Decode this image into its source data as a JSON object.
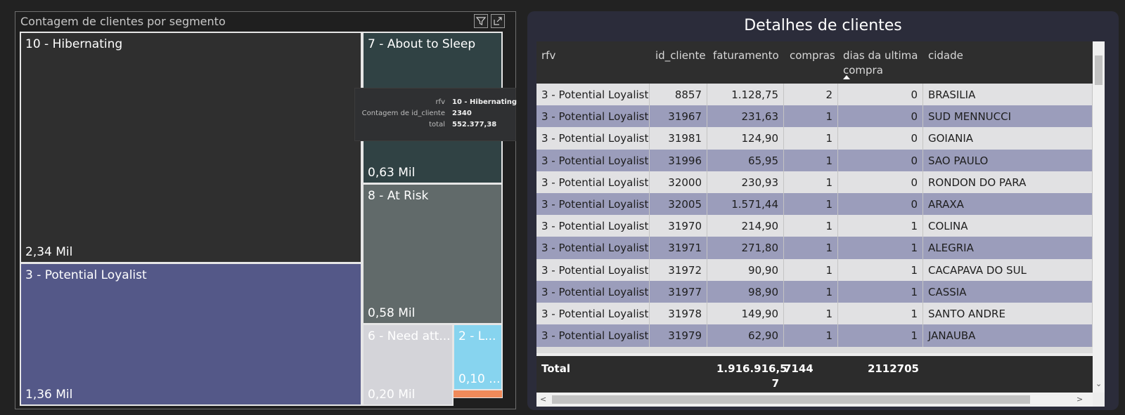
{
  "treemap": {
    "title": "Contagem de clientes por segmento",
    "icons": {
      "filter": "filter-icon",
      "focus": "focus-mode-icon"
    },
    "tiles": [
      {
        "id": "hibernating",
        "label": "10 - Hibernating",
        "value": "2,34 Mil",
        "color": "#2f2f2f"
      },
      {
        "id": "about-to-sleep",
        "label": "7 - About to Sleep",
        "value": "0,63 Mil",
        "color": "#304244"
      },
      {
        "id": "at-risk",
        "label": "8 - At Risk",
        "value": "0,58 Mil",
        "color": "#616a6a"
      },
      {
        "id": "potential-loyalist",
        "label": "3 - Potential Loyalist",
        "value": "1,36 Mil",
        "color": "#545888"
      },
      {
        "id": "need-attention",
        "label": "6 - Need att...",
        "value": "0,20 Mil",
        "color": "#d4d4d9"
      },
      {
        "id": "loyal",
        "label": "2 - L...",
        "value": "0,10 ...",
        "color": "#87d4ef"
      }
    ],
    "tooltip": {
      "rows": [
        {
          "key": "rfv",
          "value": "10 - Hibernating"
        },
        {
          "key": "Contagem de id_cliente",
          "value": "2340"
        },
        {
          "key": "total",
          "value": "552.377,38"
        }
      ]
    }
  },
  "table": {
    "title": "Detalhes de clientes",
    "columns": [
      "rfv",
      "id_cliente",
      "faturamento",
      "compras",
      "dias da ultima compra",
      "cidade"
    ],
    "sorted_column": "dias da ultima compra",
    "sort_direction": "ascending",
    "rows": [
      [
        "3 - Potential Loyalist",
        "8857",
        "1.128,75",
        "2",
        "0",
        "BRASILIA"
      ],
      [
        "3 - Potential Loyalist",
        "31967",
        "231,63",
        "1",
        "0",
        "SUD MENNUCCI"
      ],
      [
        "3 - Potential Loyalist",
        "31981",
        "124,90",
        "1",
        "0",
        "GOIANIA"
      ],
      [
        "3 - Potential Loyalist",
        "31996",
        "65,95",
        "1",
        "0",
        "SAO PAULO"
      ],
      [
        "3 - Potential Loyalist",
        "32000",
        "230,93",
        "1",
        "0",
        "RONDON DO PARA"
      ],
      [
        "3 - Potential Loyalist",
        "32005",
        "1.571,44",
        "1",
        "0",
        "ARAXA"
      ],
      [
        "3 - Potential Loyalist",
        "31970",
        "214,90",
        "1",
        "1",
        "COLINA"
      ],
      [
        "3 - Potential Loyalist",
        "31971",
        "271,80",
        "1",
        "1",
        "ALEGRIA"
      ],
      [
        "3 - Potential Loyalist",
        "31972",
        "90,90",
        "1",
        "1",
        "CACAPAVA DO SUL"
      ],
      [
        "3 - Potential Loyalist",
        "31977",
        "98,90",
        "1",
        "1",
        "CASSIA"
      ],
      [
        "3 - Potential Loyalist",
        "31978",
        "149,90",
        "1",
        "1",
        "SANTO ANDRE"
      ],
      [
        "3 - Potential Loyalist",
        "31979",
        "62,90",
        "1",
        "1",
        "JANAUBA"
      ]
    ],
    "total": {
      "label": "Total",
      "faturamento_line1": "1.916.916,5",
      "faturamento_line2": "7",
      "compras": "7144",
      "dias": "2112705"
    },
    "row_colors": {
      "odd": "#e1e1e3",
      "even": "#9b9dbb"
    }
  }
}
